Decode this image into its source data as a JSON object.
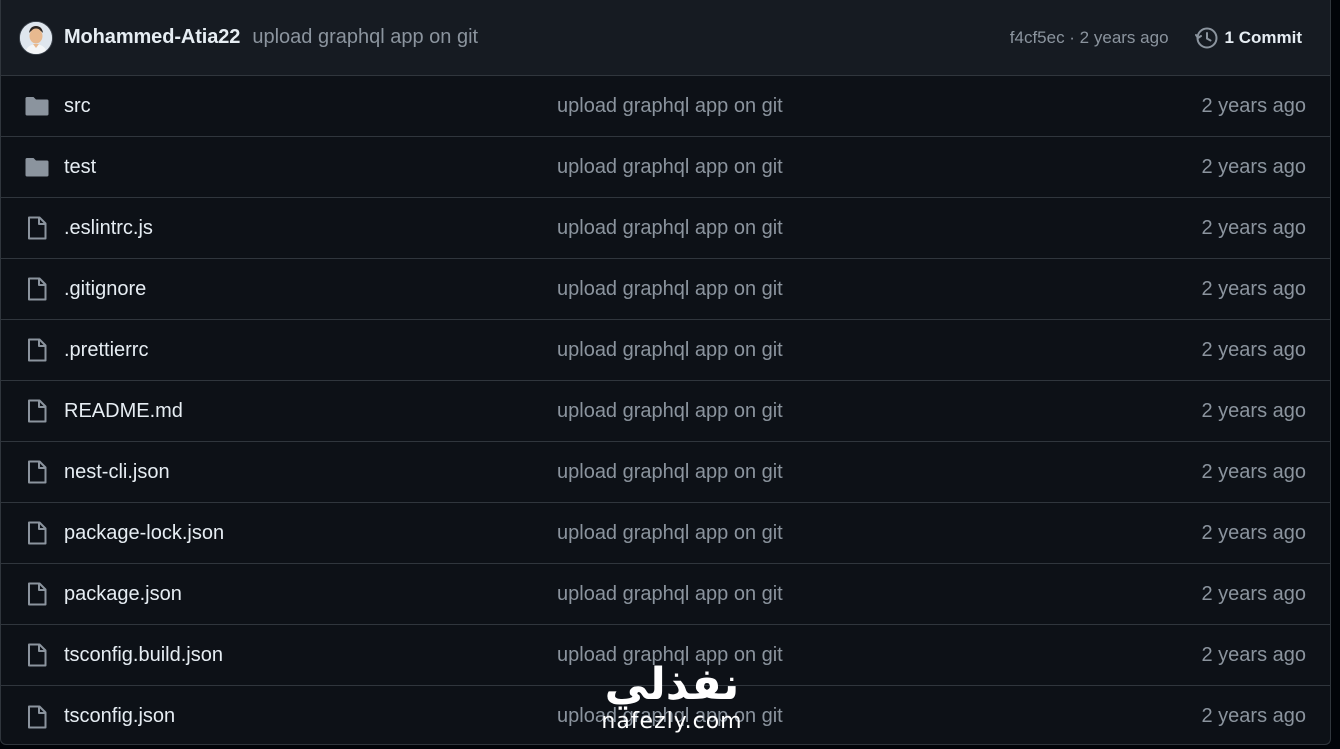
{
  "latest_commit": {
    "author": "Mohammed-Atia22",
    "message": "upload graphql app on git",
    "sha_and_time": "f4cf5ec · 2 years ago",
    "commit_count": "1 Commit"
  },
  "files": [
    {
      "name": "src",
      "type": "folder",
      "icon": "folder-icon",
      "message": "upload graphql app on git",
      "date": "2 years ago"
    },
    {
      "name": "test",
      "type": "folder",
      "icon": "folder-icon",
      "message": "upload graphql app on git",
      "date": "2 years ago"
    },
    {
      "name": ".eslintrc.js",
      "type": "file",
      "icon": "file-icon",
      "message": "upload graphql app on git",
      "date": "2 years ago"
    },
    {
      "name": ".gitignore",
      "type": "file",
      "icon": "file-icon",
      "message": "upload graphql app on git",
      "date": "2 years ago"
    },
    {
      "name": ".prettierrc",
      "type": "file",
      "icon": "file-icon",
      "message": "upload graphql app on git",
      "date": "2 years ago"
    },
    {
      "name": "README.md",
      "type": "file",
      "icon": "file-icon",
      "message": "upload graphql app on git",
      "date": "2 years ago"
    },
    {
      "name": "nest-cli.json",
      "type": "file",
      "icon": "file-icon",
      "message": "upload graphql app on git",
      "date": "2 years ago"
    },
    {
      "name": "package-lock.json",
      "type": "file",
      "icon": "file-icon",
      "message": "upload graphql app on git",
      "date": "2 years ago"
    },
    {
      "name": "package.json",
      "type": "file",
      "icon": "file-icon",
      "message": "upload graphql app on git",
      "date": "2 years ago"
    },
    {
      "name": "tsconfig.build.json",
      "type": "file",
      "icon": "file-icon",
      "message": "upload graphql app on git",
      "date": "2 years ago"
    },
    {
      "name": "tsconfig.json",
      "type": "file",
      "icon": "file-icon",
      "message": "upload graphql app on git",
      "date": "2 years ago"
    }
  ],
  "watermark": {
    "arabic": "نفذلي",
    "latin": "nafezly.com"
  },
  "colors": {
    "background": "#0d1117",
    "header_background": "#161b22",
    "border": "#30363d",
    "text_primary": "#e6edf3",
    "text_muted": "#8b949e",
    "icon": "#8b949e"
  }
}
